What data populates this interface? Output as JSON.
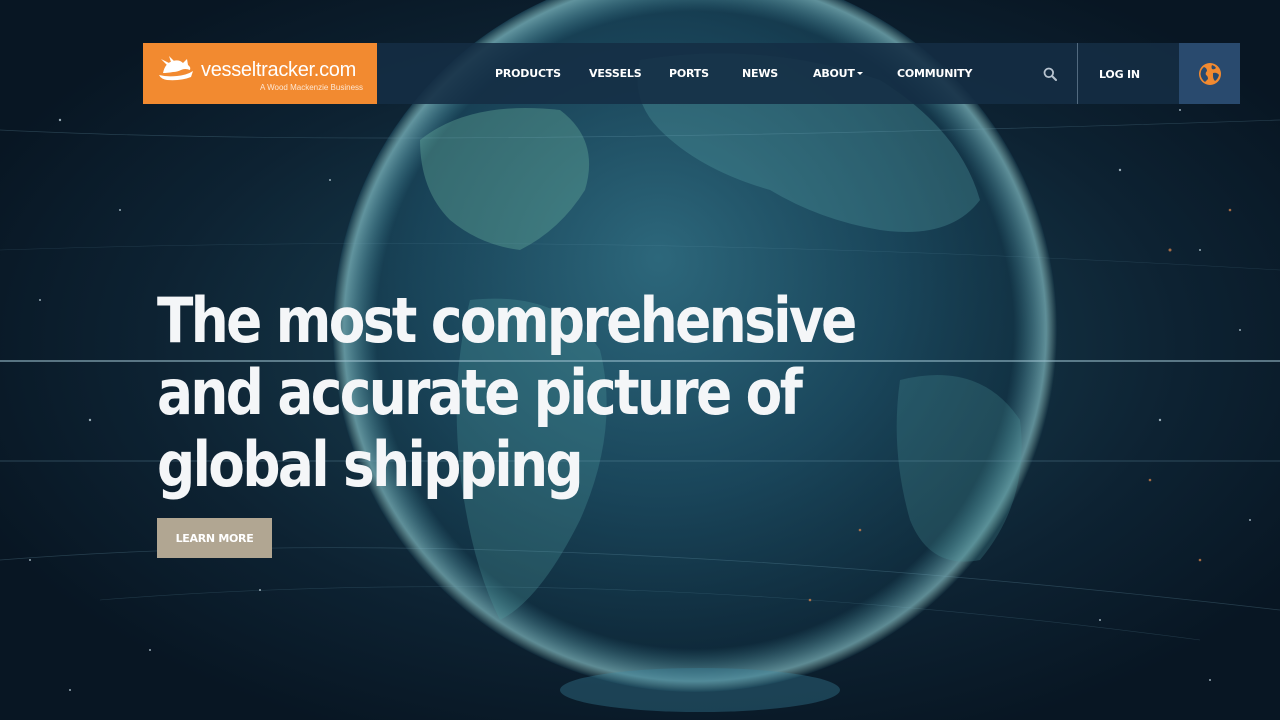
{
  "brand": {
    "name": "vesseltracker.com",
    "tagline": "A Wood Mackenzie Business",
    "logo_icon": "dragon-ship-icon",
    "brand_color": "#f28a30"
  },
  "nav": {
    "items": [
      {
        "label": "PRODUCTS",
        "dropdown": false
      },
      {
        "label": "VESSELS",
        "dropdown": false
      },
      {
        "label": "PORTS",
        "dropdown": false
      },
      {
        "label": "NEWS",
        "dropdown": false
      },
      {
        "label": "ABOUT",
        "dropdown": true
      },
      {
        "label": "COMMUNITY",
        "dropdown": false
      }
    ],
    "search_icon": "search-icon",
    "login_label": "LOG IN",
    "language_icon": "uk-flag-icon",
    "globe_icon": "globe-icon",
    "globe_button_color": "#294a6e"
  },
  "hero": {
    "headline": "The most comprehensive and accurate picture of global shipping",
    "cta_label": "LEARN MORE",
    "cta_color": "#b1a692"
  }
}
